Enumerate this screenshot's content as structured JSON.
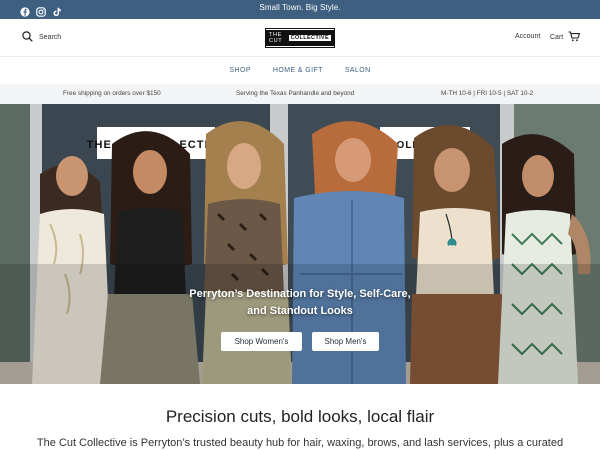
{
  "announcement": {
    "message": "Small Town. Big Style.",
    "socials": [
      "facebook-icon",
      "instagram-icon",
      "tiktok-icon"
    ]
  },
  "header": {
    "search_label": "Search",
    "logo_the": "THE CUT",
    "logo_collective": "COLLECTIVE",
    "account_label": "Account",
    "cart_label": "Cart"
  },
  "nav": {
    "items": [
      {
        "label": "SHOP"
      },
      {
        "label": "HOME & GIFT"
      },
      {
        "label": "SALON"
      }
    ]
  },
  "infobar": {
    "shipping": "Free shipping on orders over $150",
    "serving": "Serving the Texas Panhandle and beyond",
    "hours": "M-TH 10-6 | FRI 10-5 | SAT 10-2"
  },
  "hero": {
    "sign_left": "THE CUT COLLECTIVE",
    "sign_right": "COLLECTIVE",
    "caption_line1": "Perryton’s Destination for Style, Self-Care,",
    "caption_line2": "and Standout Looks",
    "btn_womens": "Shop Women's",
    "btn_mens": "Shop Men's"
  },
  "intro": {
    "headline": "Precision cuts, bold looks, local flair",
    "text": "The Cut Collective is Perryton’s trusted beauty hub for hair, waxing, brows, and lash services, plus a curated"
  },
  "colors": {
    "announcement_bg": "#3e5f7f",
    "nav_text": "#3e5f7f",
    "infobar_bg": "#f3f4f5"
  }
}
